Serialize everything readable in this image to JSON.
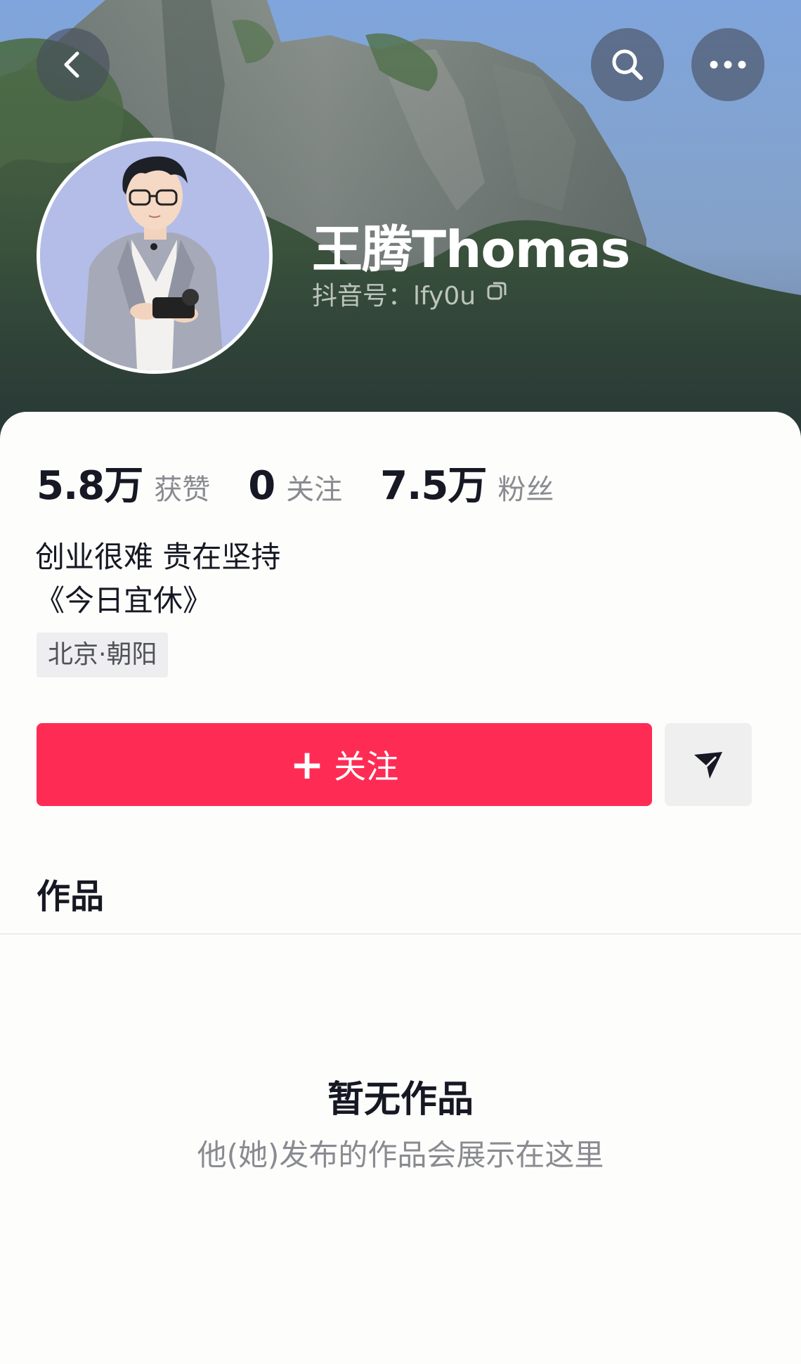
{
  "profile": {
    "name": "王腾Thomas",
    "douyin_id": "抖音号：lfy0u",
    "bio_line1": "创业很难 贵在坚持",
    "bio_line2": "《今日宜休》",
    "location_tag": "北京·朝阳"
  },
  "stats": {
    "likes_value": "5.8万",
    "likes_label": "获赞",
    "following_value": "0",
    "following_label": "关注",
    "followers_value": "7.5万",
    "followers_label": "粉丝"
  },
  "actions": {
    "follow_plus": "+",
    "follow_label": "关注"
  },
  "works": {
    "tab_label": "作品",
    "empty_title": "暂无作品",
    "empty_subtitle": "他(她)发布的作品会展示在这里"
  },
  "icons": {
    "back": "back-chevron-icon",
    "search": "search-icon",
    "more": "more-icon",
    "copy": "copy-icon",
    "message": "send-message-icon"
  },
  "colors": {
    "accent": "#fe2c55",
    "text_primary": "#161823",
    "text_secondary": "#8a8b91"
  }
}
